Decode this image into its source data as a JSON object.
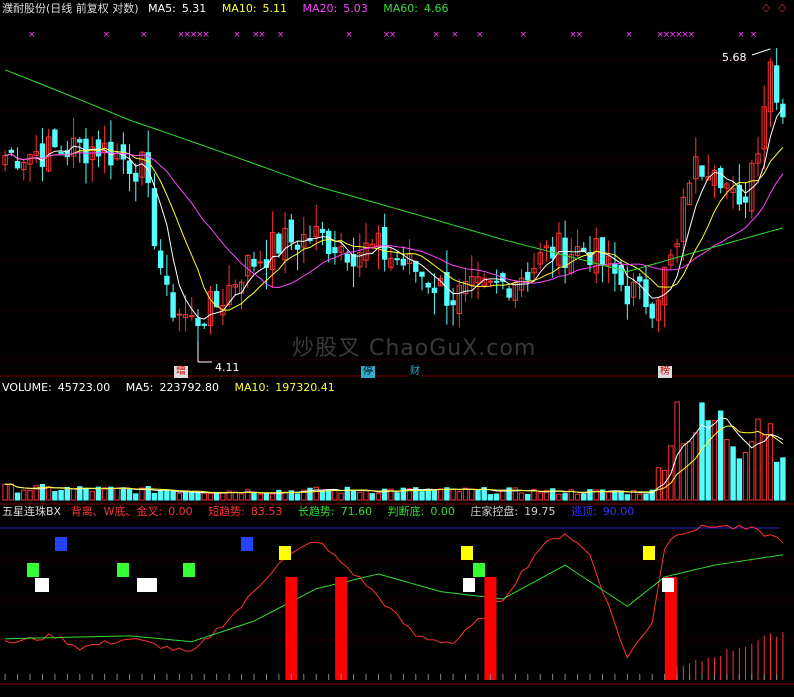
{
  "header_main": {
    "stock": "濮耐股份(日线 前复权 对数)",
    "items": [
      {
        "label": "MA5:",
        "value": "5.31",
        "color": "#ffffff"
      },
      {
        "label": "MA10:",
        "value": "5.11",
        "color": "#ffff33"
      },
      {
        "label": "MA20:",
        "value": "5.03",
        "color": "#ff44ff"
      },
      {
        "label": "MA60:",
        "value": "4.66",
        "color": "#33dd33"
      }
    ]
  },
  "header_volume": {
    "items": [
      {
        "label": "VOLUME:",
        "value": "45723.00",
        "color": "#ffffff"
      },
      {
        "label": "MA5:",
        "value": "223792.80",
        "color": "#ffffff"
      },
      {
        "label": "MA10:",
        "value": "197320.41",
        "color": "#ffff33"
      }
    ]
  },
  "header_indicator": {
    "name": "五星连珠BX",
    "items": [
      {
        "label": "背离、W底、金叉:",
        "value": "0.00",
        "color": "#ff3333"
      },
      {
        "label": "短趋势:",
        "value": "83.53",
        "color": "#ff3333"
      },
      {
        "label": "长趋势:",
        "value": "71.60",
        "color": "#33dd33"
      },
      {
        "label": "判断底:",
        "value": "0.00",
        "color": "#33dd33"
      },
      {
        "label": "庄家控盘:",
        "value": "19.75",
        "color": "#cccccc"
      },
      {
        "label": "逃顶:",
        "value": "90.00",
        "color": "#3333ff"
      }
    ]
  },
  "corner_icons": [
    "diamond-icon",
    "diamond-icon"
  ],
  "markers": [
    {
      "text": "增",
      "bg": "#dddddd",
      "fg": "#cc0000"
    },
    {
      "text": "停",
      "bg": "#33aacc",
      "fg": "#000000"
    },
    {
      "text": "财",
      "bg": "#000000",
      "fg": "#33aacc"
    },
    {
      "text": "榜",
      "bg": "#dddddd",
      "fg": "#cc0000"
    }
  ],
  "annotations": {
    "high": "5.68",
    "low": "4.11"
  },
  "watermark": "炒股叉 ChaoGuX.com",
  "colors": {
    "up": "#ff3232",
    "down": "#54fcfc",
    "ma5": "#ffffff",
    "ma10": "#ffff33",
    "ma20": "#ff44ff",
    "ma60": "#33dd33",
    "bg": "#000000"
  },
  "chart_data": [
    {
      "type": "candlestick",
      "title": "濮耐股份(日线 前复权 对数)",
      "scale": "log",
      "x_bars": 126,
      "ylim": [
        4.0,
        5.8
      ],
      "series_lines": [
        "MA5",
        "MA10",
        "MA20",
        "MA60"
      ],
      "price_points": [
        [
          0,
          5.05
        ],
        [
          8,
          5.08
        ],
        [
          15,
          5.1
        ],
        [
          22,
          4.98
        ],
        [
          26,
          4.3
        ],
        [
          30,
          4.2
        ],
        [
          34,
          4.28
        ],
        [
          38,
          4.45
        ],
        [
          44,
          4.58
        ],
        [
          50,
          4.62
        ],
        [
          56,
          4.55
        ],
        [
          60,
          4.55
        ],
        [
          66,
          4.45
        ],
        [
          72,
          4.32
        ],
        [
          78,
          4.35
        ],
        [
          84,
          4.45
        ],
        [
          88,
          4.55
        ],
        [
          94,
          4.55
        ],
        [
          100,
          4.35
        ],
        [
          104,
          4.3
        ],
        [
          108,
          4.55
        ],
        [
          110,
          4.95
        ],
        [
          114,
          5.05
        ],
        [
          118,
          4.72
        ],
        [
          121,
          5.15
        ],
        [
          123,
          5.6
        ],
        [
          125,
          5.3
        ]
      ],
      "ma60_points": [
        [
          0,
          5.55
        ],
        [
          20,
          5.25
        ],
        [
          50,
          4.88
        ],
        [
          80,
          4.6
        ],
        [
          100,
          4.44
        ],
        [
          125,
          4.66
        ]
      ],
      "annotations": [
        {
          "bar": 31,
          "value": 4.11
        },
        {
          "bar": 123,
          "value": 5.68
        }
      ]
    },
    {
      "type": "bar",
      "title": "VOLUME",
      "values_desc": "low flat volume then spike in last bars",
      "volume_points": [
        [
          0,
          0.12
        ],
        [
          20,
          0.1
        ],
        [
          40,
          0.09
        ],
        [
          60,
          0.1
        ],
        [
          80,
          0.09
        ],
        [
          100,
          0.08
        ],
        [
          104,
          0.08
        ],
        [
          106,
          0.5
        ],
        [
          108,
          0.95
        ],
        [
          110,
          0.7
        ],
        [
          114,
          0.8
        ],
        [
          118,
          0.6
        ],
        [
          121,
          0.9
        ],
        [
          125,
          0.55
        ]
      ],
      "ylim": [
        0,
        1
      ]
    },
    {
      "type": "line",
      "title": "五星连珠BX",
      "short_trend_points": [
        [
          0,
          25
        ],
        [
          8,
          30
        ],
        [
          12,
          22
        ],
        [
          20,
          28
        ],
        [
          30,
          18
        ],
        [
          38,
          50
        ],
        [
          44,
          80
        ],
        [
          50,
          95
        ],
        [
          54,
          80
        ],
        [
          58,
          65
        ],
        [
          66,
          30
        ],
        [
          72,
          25
        ],
        [
          80,
          55
        ],
        [
          86,
          90
        ],
        [
          90,
          100
        ],
        [
          94,
          85
        ],
        [
          100,
          15
        ],
        [
          104,
          40
        ],
        [
          106,
          90
        ],
        [
          108,
          100
        ],
        [
          114,
          105
        ],
        [
          120,
          102
        ],
        [
          125,
          95
        ]
      ],
      "long_trend_points": [
        [
          0,
          28
        ],
        [
          20,
          30
        ],
        [
          30,
          26
        ],
        [
          40,
          40
        ],
        [
          50,
          62
        ],
        [
          60,
          72
        ],
        [
          70,
          60
        ],
        [
          80,
          55
        ],
        [
          90,
          78
        ],
        [
          100,
          50
        ],
        [
          106,
          70
        ],
        [
          114,
          78
        ],
        [
          125,
          85
        ]
      ],
      "red_bars": [
        {
          "bar": 46,
          "value": 70
        },
        {
          "bar": 54,
          "value": 70
        },
        {
          "bar": 78,
          "value": 70
        },
        {
          "bar": 107,
          "value": 70
        }
      ],
      "ylim": [
        0,
        110
      ]
    }
  ]
}
